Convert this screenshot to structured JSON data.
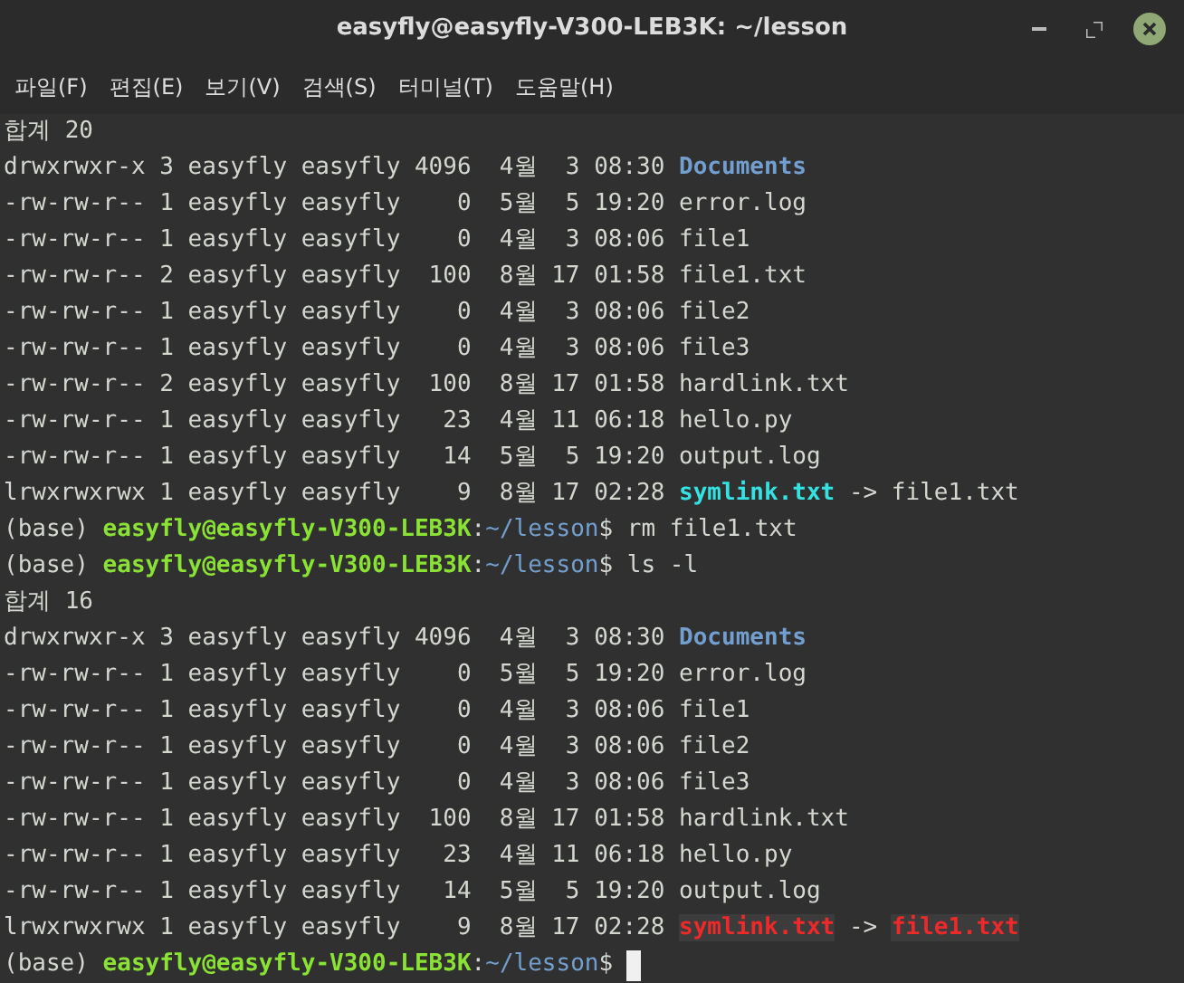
{
  "window": {
    "title": "easyfly@easyfly-V300-LEB3K: ~/lesson"
  },
  "menu": [
    "파일(F)",
    "편집(E)",
    "보기(V)",
    "검색(S)",
    "터미널(T)",
    "도움말(H)"
  ],
  "lines": [
    {
      "segments": [
        {
          "kind": "plain",
          "text": "합계 20"
        }
      ]
    },
    {
      "segments": [
        {
          "kind": "plain",
          "text": "drwxrwxr-x 3 easyfly easyfly 4096  4월  3 08:30 "
        },
        {
          "kind": "dir",
          "text": "Documents"
        }
      ]
    },
    {
      "segments": [
        {
          "kind": "plain",
          "text": "-rw-rw-r-- 1 easyfly easyfly    0  5월  5 19:20 error.log"
        }
      ]
    },
    {
      "segments": [
        {
          "kind": "plain",
          "text": "-rw-rw-r-- 1 easyfly easyfly    0  4월  3 08:06 file1"
        }
      ]
    },
    {
      "segments": [
        {
          "kind": "plain",
          "text": "-rw-rw-r-- 2 easyfly easyfly  100  8월 17 01:58 file1.txt"
        }
      ]
    },
    {
      "segments": [
        {
          "kind": "plain",
          "text": "-rw-rw-r-- 1 easyfly easyfly    0  4월  3 08:06 file2"
        }
      ]
    },
    {
      "segments": [
        {
          "kind": "plain",
          "text": "-rw-rw-r-- 1 easyfly easyfly    0  4월  3 08:06 file3"
        }
      ]
    },
    {
      "segments": [
        {
          "kind": "plain",
          "text": "-rw-rw-r-- 2 easyfly easyfly  100  8월 17 01:58 hardlink.txt"
        }
      ]
    },
    {
      "segments": [
        {
          "kind": "plain",
          "text": "-rw-rw-r-- 1 easyfly easyfly   23  4월 11 06:18 hello.py"
        }
      ]
    },
    {
      "segments": [
        {
          "kind": "plain",
          "text": "-rw-rw-r-- 1 easyfly easyfly   14  5월  5 19:20 output.log"
        }
      ]
    },
    {
      "segments": [
        {
          "kind": "plain",
          "text": "lrwxrwxrwx 1 easyfly easyfly    9  8월 17 02:28 "
        },
        {
          "kind": "link",
          "text": "symlink.txt"
        },
        {
          "kind": "plain",
          "text": " -> file1.txt"
        }
      ]
    },
    {
      "segments": [
        {
          "kind": "plain",
          "text": "(base) "
        },
        {
          "kind": "user",
          "text": "easyfly@easyfly-V300-LEB3K"
        },
        {
          "kind": "plain",
          "text": ":"
        },
        {
          "kind": "path",
          "text": "~/lesson"
        },
        {
          "kind": "plain",
          "text": "$ rm file1.txt"
        }
      ]
    },
    {
      "segments": [
        {
          "kind": "plain",
          "text": "(base) "
        },
        {
          "kind": "user",
          "text": "easyfly@easyfly-V300-LEB3K"
        },
        {
          "kind": "plain",
          "text": ":"
        },
        {
          "kind": "path",
          "text": "~/lesson"
        },
        {
          "kind": "plain",
          "text": "$ ls -l"
        }
      ]
    },
    {
      "segments": [
        {
          "kind": "plain",
          "text": "합계 16"
        }
      ]
    },
    {
      "segments": [
        {
          "kind": "plain",
          "text": "drwxrwxr-x 3 easyfly easyfly 4096  4월  3 08:30 "
        },
        {
          "kind": "dir",
          "text": "Documents"
        }
      ]
    },
    {
      "segments": [
        {
          "kind": "plain",
          "text": "-rw-rw-r-- 1 easyfly easyfly    0  5월  5 19:20 error.log"
        }
      ]
    },
    {
      "segments": [
        {
          "kind": "plain",
          "text": "-rw-rw-r-- 1 easyfly easyfly    0  4월  3 08:06 file1"
        }
      ]
    },
    {
      "segments": [
        {
          "kind": "plain",
          "text": "-rw-rw-r-- 1 easyfly easyfly    0  4월  3 08:06 file2"
        }
      ]
    },
    {
      "segments": [
        {
          "kind": "plain",
          "text": "-rw-rw-r-- 1 easyfly easyfly    0  4월  3 08:06 file3"
        }
      ]
    },
    {
      "segments": [
        {
          "kind": "plain",
          "text": "-rw-rw-r-- 1 easyfly easyfly  100  8월 17 01:58 hardlink.txt"
        }
      ]
    },
    {
      "segments": [
        {
          "kind": "plain",
          "text": "-rw-rw-r-- 1 easyfly easyfly   23  4월 11 06:18 hello.py"
        }
      ]
    },
    {
      "segments": [
        {
          "kind": "plain",
          "text": "-rw-rw-r-- 1 easyfly easyfly   14  5월  5 19:20 output.log"
        }
      ]
    },
    {
      "segments": [
        {
          "kind": "plain",
          "text": "lrwxrwxrwx 1 easyfly easyfly    9  8월 17 02:28 "
        },
        {
          "kind": "broken",
          "text": "symlink.txt"
        },
        {
          "kind": "plain",
          "text": " -> "
        },
        {
          "kind": "broken",
          "text": "file1.txt"
        }
      ]
    },
    {
      "segments": [
        {
          "kind": "plain",
          "text": "(base) "
        },
        {
          "kind": "user",
          "text": "easyfly@easyfly-V300-LEB3K"
        },
        {
          "kind": "plain",
          "text": ":"
        },
        {
          "kind": "path",
          "text": "~/lesson"
        },
        {
          "kind": "plain",
          "text": "$ "
        }
      ],
      "cursor": true
    }
  ]
}
